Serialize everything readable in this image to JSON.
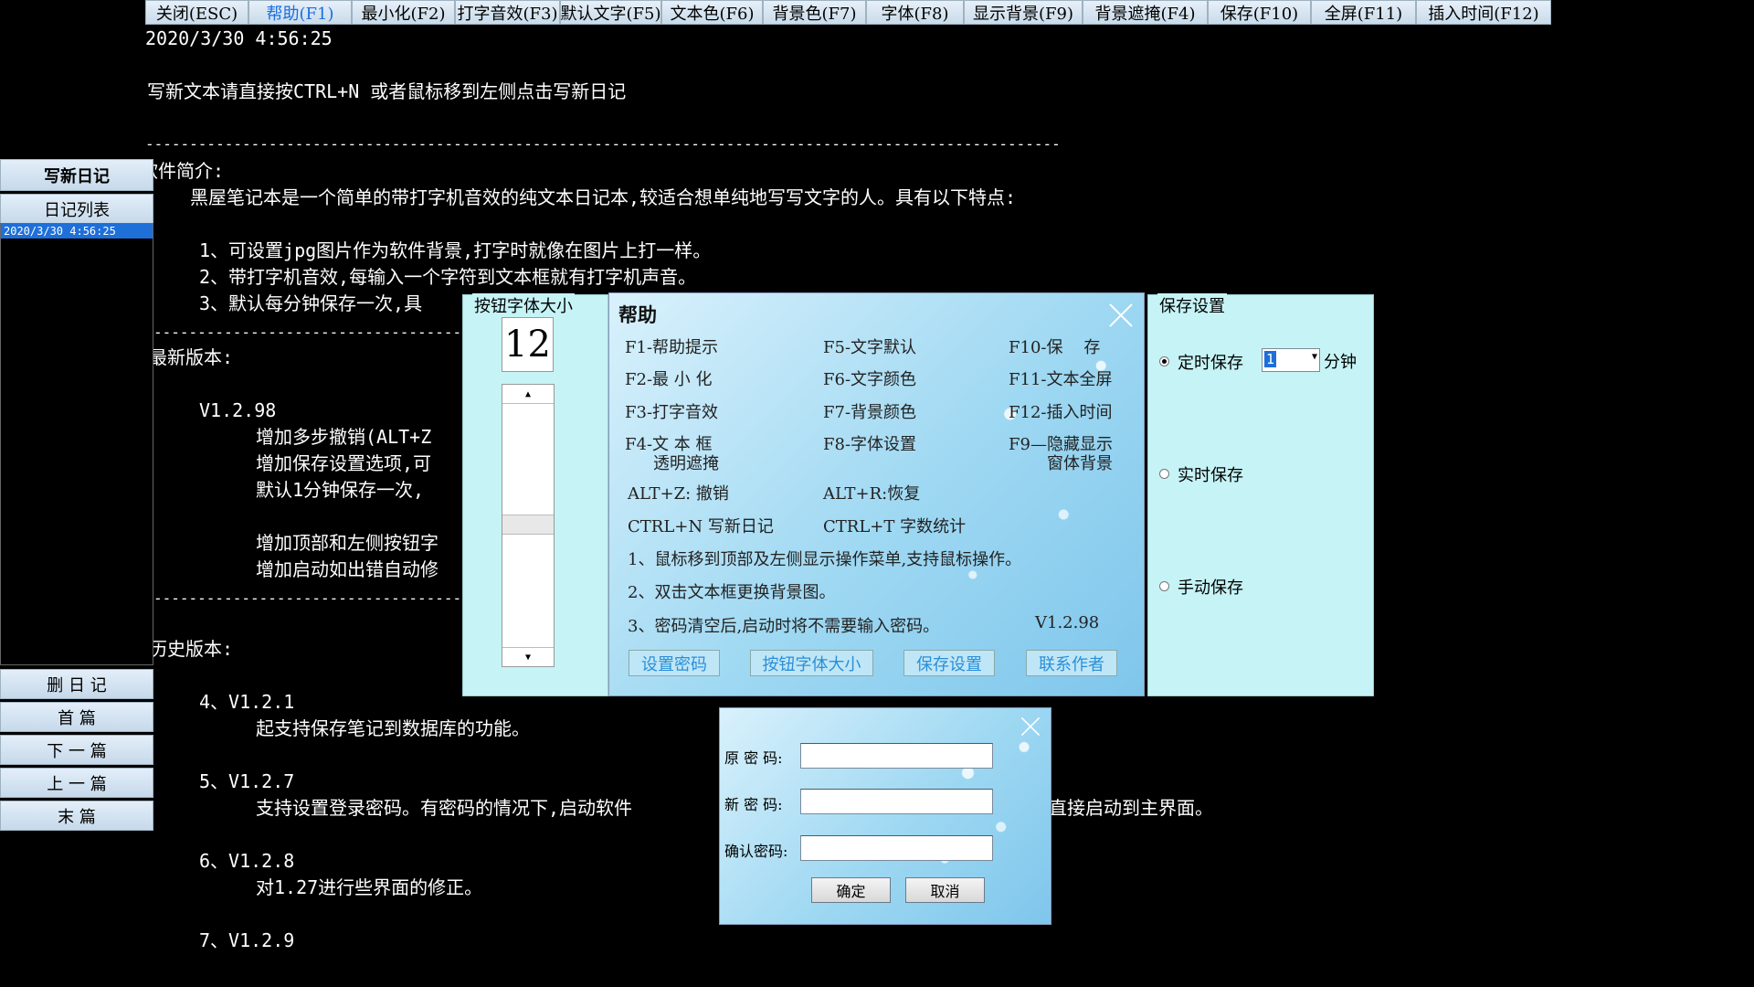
{
  "toolbar": [
    {
      "label": "关闭(ESC)",
      "name": "close-button"
    },
    {
      "label": "帮助(F1)",
      "name": "help-button",
      "active": true
    },
    {
      "label": "最小化(F2)",
      "name": "minimize-button"
    },
    {
      "label": "打字音效(F3)",
      "name": "typing-sound-button"
    },
    {
      "label": "默认文字(F5)",
      "name": "default-text-button"
    },
    {
      "label": "文本色(F6)",
      "name": "text-color-button"
    },
    {
      "label": "背景色(F7)",
      "name": "bg-color-button"
    },
    {
      "label": "字体(F8)",
      "name": "font-button"
    },
    {
      "label": "显示背景(F9)",
      "name": "show-bg-button"
    },
    {
      "label": "背景遮掩(F4)",
      "name": "bg-mask-button"
    },
    {
      "label": "保存(F10)",
      "name": "save-button"
    },
    {
      "label": "全屏(F11)",
      "name": "fullscreen-button"
    },
    {
      "label": "插入时间(F12)",
      "name": "insert-time-button"
    }
  ],
  "editor": {
    "timestamp": "2020/3/30 4:56:25",
    "hint": "写新文本请直接按CTRL+N 或者鼠标移到左侧点击写新日记",
    "divider": "--------------------------------------------------------------------------------------------------------",
    "intro_heading": "软件简介:",
    "intro_text": "黑屋笔记本是一个简单的带打字机音效的纯文本日记本,较适合想单纯地写写文字的人。具有以下特点:",
    "feature1": "1、可设置jpg图片作为软件背景,打字时就像在图片上打一样。",
    "feature2": "2、带打字机音效,每输入一个字符到文本框就有打字机声音。",
    "feature3": "3、默认每分钟保存一次,具",
    "divider2": "-----------------------------------",
    "latest_heading": "最新版本:",
    "latest_version": "V1.2.98",
    "latest_line1": "增加多步撤销(ALT+Z",
    "latest_line2": "增加保存设置选项,可",
    "latest_line3": "默认1分钟保存一次,",
    "latest_line4": "增加顶部和左侧按钮字",
    "latest_line5": "增加启动如出错自动修",
    "divider3": "-----------------------------------",
    "history_heading": "历史版本:",
    "h4_title": "4、V1.2.1",
    "h4_text": "起支持保存笔记到数据库的功能。",
    "h5_title": "5、V1.2.7",
    "h5_text": "支持设置登录密码。有密码的情况下,启动软件",
    "h5_tail": "直接启动到主界面。",
    "h6_title": "6、V1.2.8",
    "h6_text": "对1.27进行些界面的修正。",
    "h7_title": "7、V1.2.9"
  },
  "left_panel": {
    "new_diary": "写新日记",
    "diary_list": "日记列表",
    "entry": "2020/3/30 4:56:25",
    "delete": "删 日 记",
    "first": "首    篇",
    "next": "下 一 篇",
    "prev": "上 一 篇",
    "last": "末    篇"
  },
  "font_size_panel": {
    "title": "按钮字体大小",
    "value": "12"
  },
  "help": {
    "title": "帮助",
    "col1": [
      "F1-帮助提示",
      "F2-最 小 化",
      "F3-打字音效",
      "F4-文 本 框",
      "透明遮掩"
    ],
    "col2": [
      "F5-文字默认",
      "F6-文字颜色",
      "F7-背景颜色",
      "F8-字体设置"
    ],
    "col3": [
      "F10-保    存",
      "F11-文本全屏",
      "F12-插入时间",
      "F9—隐藏显示",
      "窗体背景"
    ],
    "undo": "ALT+Z: 撤销",
    "redo": "ALT+R:恢复",
    "new_diary": "CTRL+N 写新日记",
    "word_count": "CTRL+T 字数统计",
    "note1": "1、鼠标移到顶部及左侧显示操作菜单,支持鼠标操作。",
    "note2": "2、双击文本框更换背景图。",
    "note3": "3、密码清空后,启动时将不需要输入密码。",
    "version": "V1.2.98",
    "btn_password": "设置密码",
    "btn_font": "按钮字体大小",
    "btn_save": "保存设置",
    "btn_contact": "联系作者"
  },
  "save_settings": {
    "title": "保存设置",
    "timed": "定时保存",
    "minutes_value": "1",
    "minutes_unit": "分钟",
    "realtime": "实时保存",
    "manual": "手动保存"
  },
  "password": {
    "old": "原 密 码:",
    "new": "新 密 码:",
    "confirm": "确认密码:",
    "ok": "确定",
    "cancel": "取消"
  }
}
